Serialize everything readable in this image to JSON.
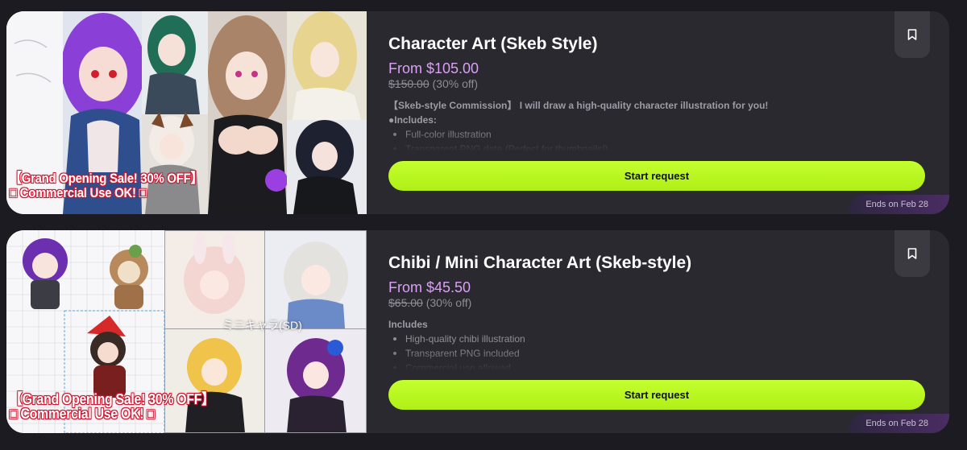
{
  "listings": [
    {
      "title": "Character Art (Skeb Style)",
      "price": "From $105.00",
      "old_price": "$150.00",
      "discount": "(30% off)",
      "description": {
        "intro": "【Skeb-style Commission】 I will draw a high-quality character illustration for you!",
        "heading": "●Includes:",
        "items": [
          "Full-color illustration",
          "Transparent PNG data (Perfect for thumbnails!)"
        ]
      },
      "promo_line1": "【Grand Opening Sale! 30% OFF】",
      "promo_line2": "□ Commercial Use OK! □",
      "cta_label": "Start request",
      "ends_label": "Ends on Feb 28",
      "bookmark_icon": "bookmark-icon"
    },
    {
      "title": "Chibi / Mini Character Art (Skeb-style)",
      "price": "From $45.50",
      "old_price": "$65.00",
      "discount": "(30% off)",
      "description": {
        "intro": "",
        "heading": "Includes",
        "items": [
          "High-quality chibi illustration",
          "Transparent PNG included",
          "Commercial use allowed"
        ]
      },
      "promo_line1": "【Grand Opening Sale! 30% OFF】",
      "promo_line2": "□ Commercial Use OK! □",
      "image_caption": "ミニキャラ(SD)",
      "cta_label": "Start request",
      "ends_label": "Ends on Feb 28",
      "bookmark_icon": "bookmark-icon"
    }
  ],
  "colors": {
    "page_bg": "#1c1b21",
    "card_bg": "#2a2930",
    "price": "#d9a0f5",
    "cta": "#bdf82a",
    "ends_bg": "#4a2d63"
  }
}
